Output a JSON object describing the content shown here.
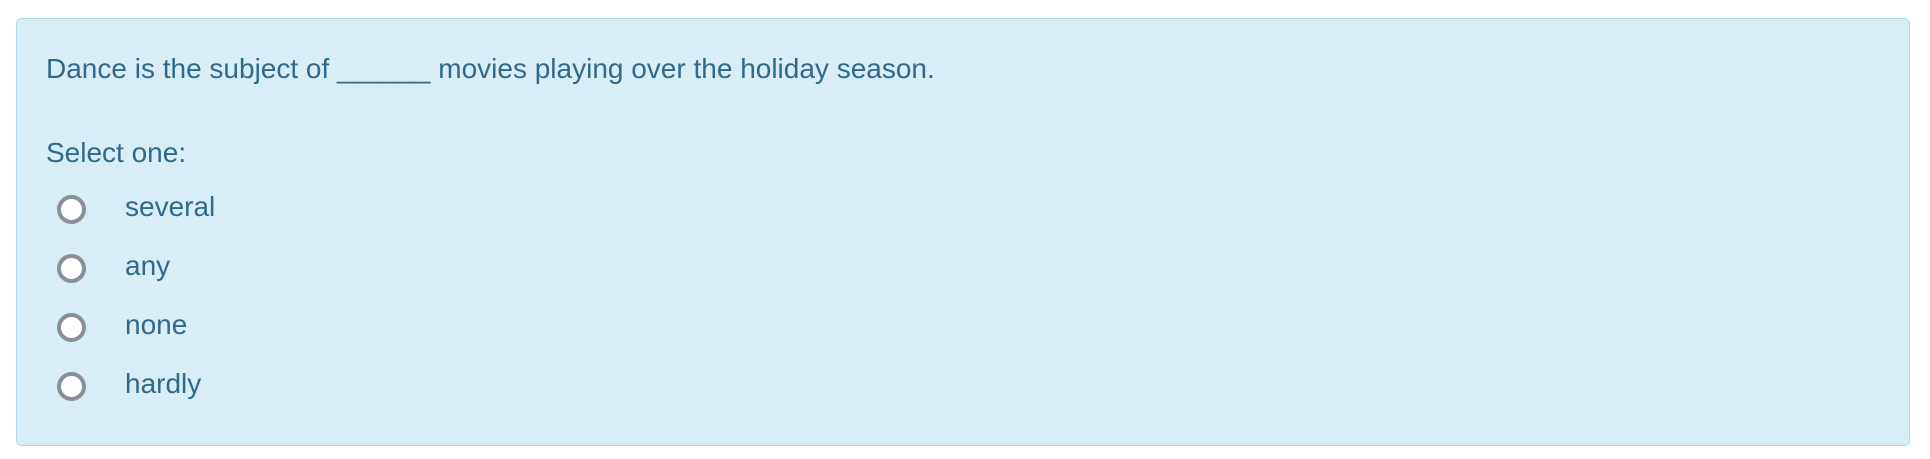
{
  "question": {
    "text": "Dance is the subject of ______ movies playing over the holiday season.",
    "prompt": "Select one:",
    "options": [
      {
        "label": "several",
        "selected": false
      },
      {
        "label": "any",
        "selected": false
      },
      {
        "label": "none",
        "selected": false
      },
      {
        "label": "hardly",
        "selected": false
      }
    ]
  },
  "colors": {
    "box_background": "#d9edf6",
    "box_border": "#b3d8ec",
    "text": "#2e6a8c",
    "radio_border": "#8a8f98"
  }
}
